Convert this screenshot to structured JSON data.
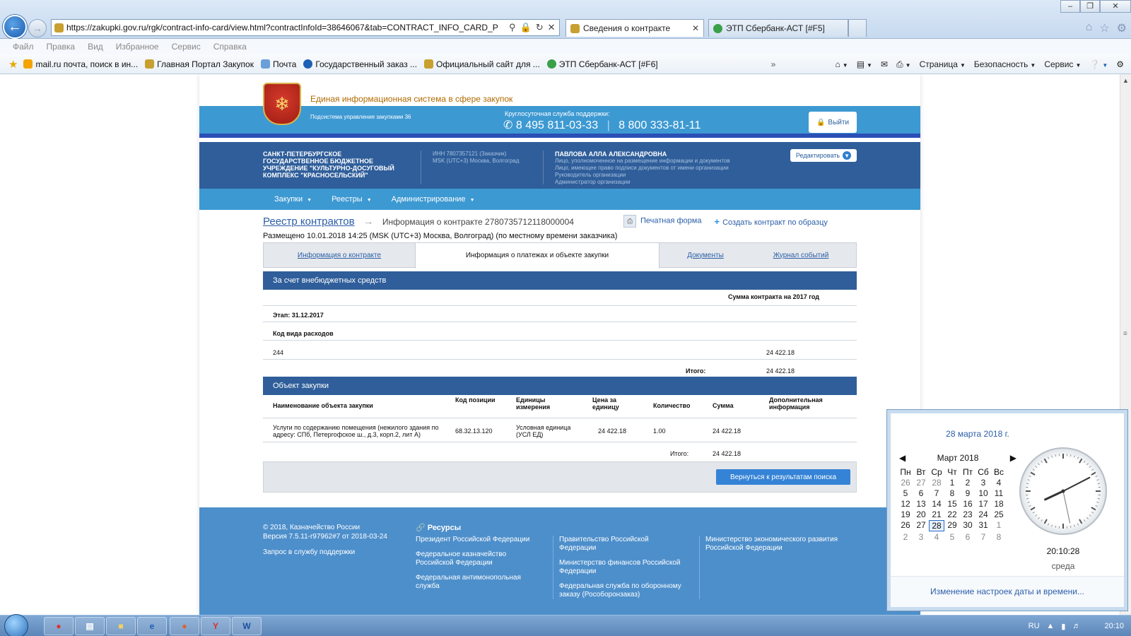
{
  "browser": {
    "url": "https://zakupki.gov.ru/rgk/contract-info-card/view.html?contractInfoId=38646067&tab=CONTRACT_INFO_CARD_P",
    "tabs": [
      {
        "label": "Сведения о контракте",
        "active": true
      },
      {
        "label": "ЭТП Сбербанк-АСТ [#F5]",
        "active": false
      }
    ],
    "menu": [
      "Файл",
      "Правка",
      "Вид",
      "Избранное",
      "Сервис",
      "Справка"
    ],
    "favorites": [
      "mail.ru почта, поиск в ин...",
      "Главная Портал Закупок",
      "Почта",
      "Государственный заказ ...",
      "Официальный сайт для ...",
      "ЭТП Сбербанк-АСТ [#F6]"
    ],
    "commands": [
      "Страница",
      "Безопасность",
      "Сервис"
    ]
  },
  "header": {
    "system_title": "Единая информационная система в сфере закупок",
    "subsystem": "Подсистема управления закупками 36",
    "support_label": "Круглосуточная служба поддержки:",
    "phone1": "8 495 811-03-33",
    "phone2": "8 800 333-81-11",
    "logout": "Выйти"
  },
  "org": {
    "name": "САНКТ-ПЕТЕРБУРГСКОЕ ГОСУДАРСТВЕННОЕ БЮДЖЕТНОЕ УЧРЕЖДЕНИЕ \"КУЛЬТУРНО-ДОСУГОВЫЙ КОМПЛЕКС \"КРАСНОСЕЛЬСКИЙ\"",
    "inn": "ИНН 7807357121 (Заказчик)",
    "tz": "MSK (UTC+3) Москва, Волгоград",
    "user_name": "ПАВЛОВА АЛЛА АЛЕКСАНДРОВНА",
    "roles": [
      "Лицо, уполномоченное на размещение информации и документов",
      "Лицо, имеющее право подписи документов от имени организации",
      "Руководитель организации",
      "Администратор организации"
    ],
    "edit": "Редактировать"
  },
  "nav": [
    "Закупки",
    "Реестры",
    "Администрирование"
  ],
  "page": {
    "breadcrumb_link": "Реестр контрактов",
    "breadcrumb_current": "Информация о контракте 2780735712118000004",
    "placed": "Размещено 10.01.2018 14:25 (MSK (UTC+3) Москва, Волгоград) (по местному времени заказчика)",
    "print": "Печатная форма",
    "create": "Создать контракт по образцу",
    "tabs": [
      "Информация о контракте",
      "Информация о платежах и объекте закупки",
      "Документы",
      "Журнал событий"
    ]
  },
  "finance": {
    "title": "За счет внебюджетных средств",
    "col_header": "Сумма контракта на 2017 год",
    "stage": "Этап: 31.12.2017",
    "code_label": "Код вида расходов",
    "code": "244",
    "amount": "24 422.18",
    "total_label": "Итого:",
    "total": "24 422.18"
  },
  "object": {
    "title": "Объект закупки",
    "headers": [
      "Наименование объекта закупки",
      "Код позиции",
      "Единицы измерения",
      "Цена за единицу",
      "Количество",
      "Сумма",
      "Дополнительная информация"
    ],
    "row": {
      "name": "Услуги по содержанию помещения (нежилого здания по адресу: СПб, Петергофское ш., д.3, корп.2, лит А)",
      "code": "68.32.13.120",
      "unit": "Условная единица (УСЛ ЕД)",
      "price": "24 422.18",
      "qty": "1.00",
      "sum": "24 422.18"
    },
    "total_label": "Итого:",
    "total": "24 422.18",
    "back": "Вернуться к результатам поиска"
  },
  "footer": {
    "copyright": "© 2018, Казначейство России",
    "version": "Версия 7.5.11-r97962#7 от 2018-03-24",
    "support": "Запрос в службу поддержки",
    "resources": "Ресурсы",
    "col1": [
      "Президент Российской Федерации",
      "Федеральное казначейство Российской Федерации",
      "Федеральная антимонопольная служба"
    ],
    "col2": [
      "Правительство Российской Федерации",
      "Министерство финансов Российской Федерации",
      "Федеральная служба по оборонному заказу (Рособоронзаказ)"
    ],
    "col3": [
      "Министерство экономического развития Российской Федерации"
    ]
  },
  "calendar": {
    "date_long": "28 марта 2018 г.",
    "month": "Март 2018",
    "dow": [
      "Пн",
      "Вт",
      "Ср",
      "Чт",
      "Пт",
      "Сб",
      "Вс"
    ],
    "days": [
      {
        "d": "26",
        "o": true
      },
      {
        "d": "27",
        "o": true
      },
      {
        "d": "28",
        "o": true
      },
      {
        "d": "1"
      },
      {
        "d": "2"
      },
      {
        "d": "3"
      },
      {
        "d": "4"
      },
      {
        "d": "5"
      },
      {
        "d": "6"
      },
      {
        "d": "7"
      },
      {
        "d": "8"
      },
      {
        "d": "9"
      },
      {
        "d": "10"
      },
      {
        "d": "11"
      },
      {
        "d": "12"
      },
      {
        "d": "13"
      },
      {
        "d": "14"
      },
      {
        "d": "15"
      },
      {
        "d": "16"
      },
      {
        "d": "17"
      },
      {
        "d": "18"
      },
      {
        "d": "19"
      },
      {
        "d": "20"
      },
      {
        "d": "21"
      },
      {
        "d": "22"
      },
      {
        "d": "23"
      },
      {
        "d": "24"
      },
      {
        "d": "25"
      },
      {
        "d": "26"
      },
      {
        "d": "27"
      },
      {
        "d": "28",
        "today": true
      },
      {
        "d": "29"
      },
      {
        "d": "30"
      },
      {
        "d": "31"
      },
      {
        "d": "1",
        "o": true
      },
      {
        "d": "2",
        "o": true
      },
      {
        "d": "3",
        "o": true
      },
      {
        "d": "4",
        "o": true
      },
      {
        "d": "5",
        "o": true
      },
      {
        "d": "6",
        "o": true
      },
      {
        "d": "7",
        "o": true
      },
      {
        "d": "8",
        "o": true
      }
    ],
    "time": "20:10:28",
    "weekday": "среда",
    "settings_link": "Изменение настроек даты и времени..."
  },
  "taskbar": {
    "lang": "RU",
    "clock": "20:10"
  }
}
